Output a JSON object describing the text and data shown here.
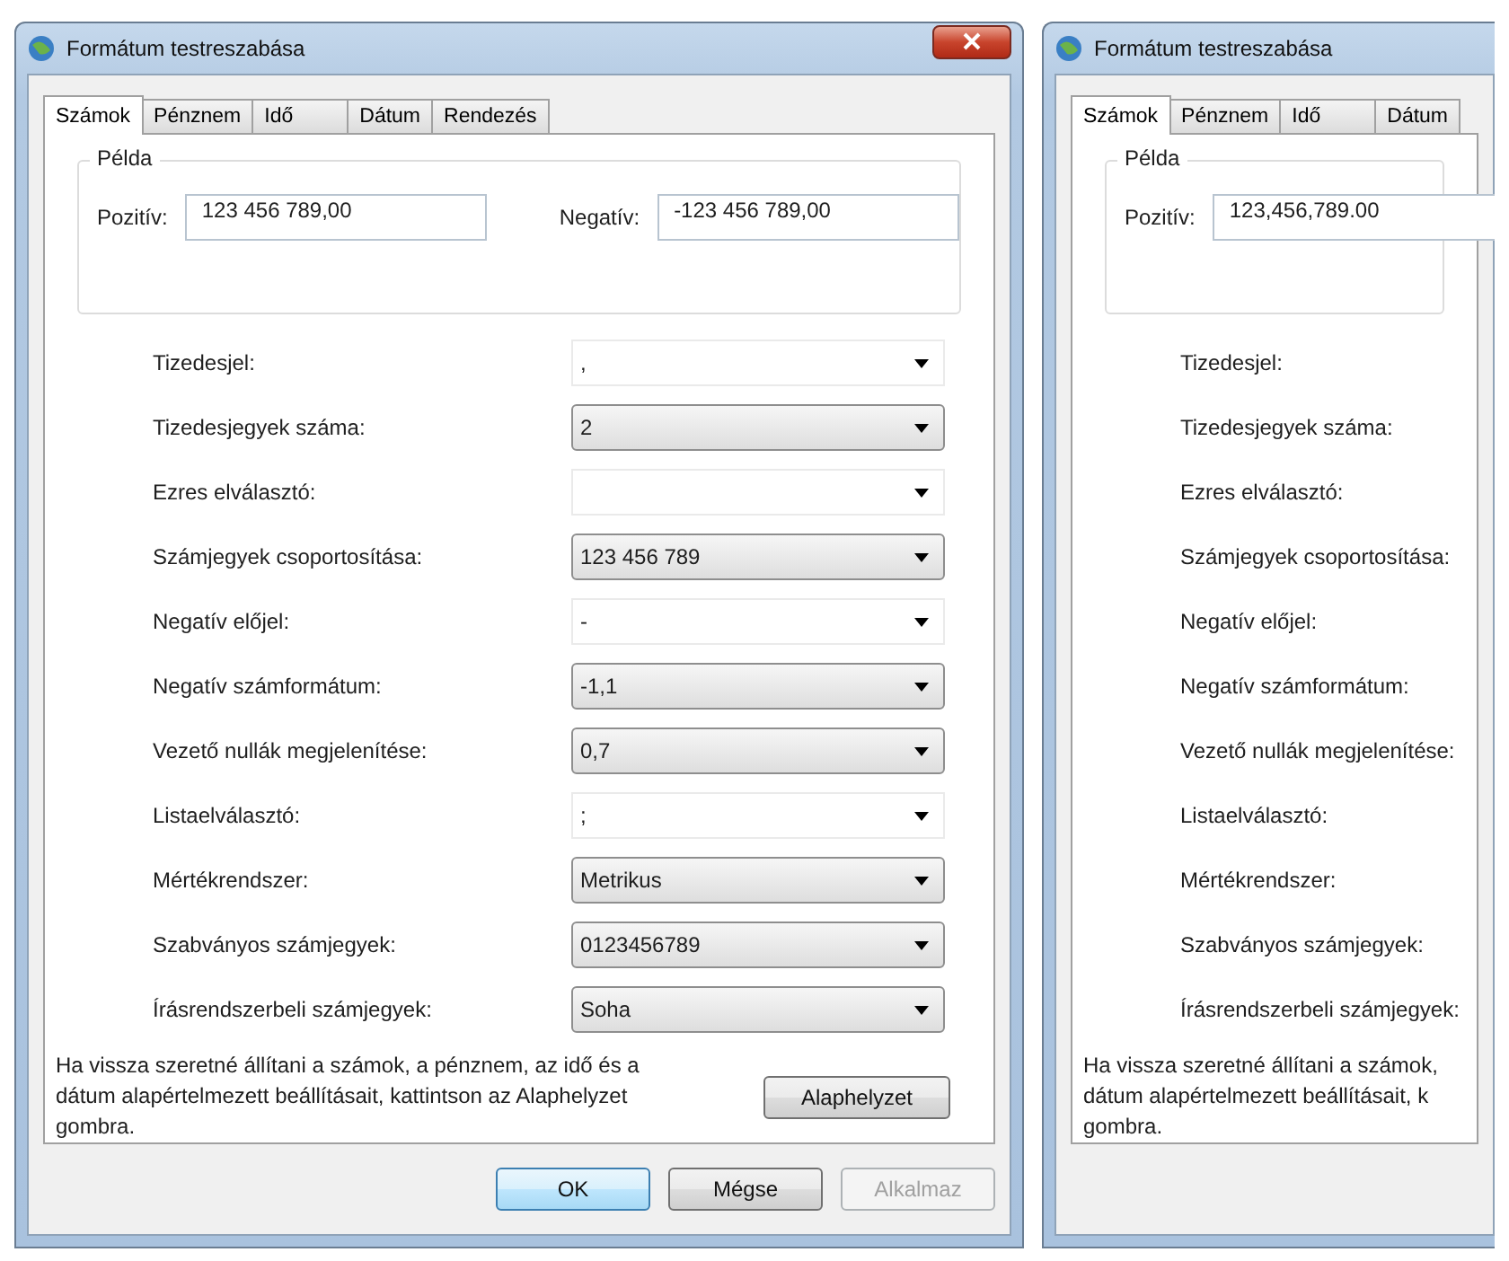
{
  "dialogs": [
    {
      "title": "Formátum testreszabása",
      "close_button": true,
      "tabs": [
        {
          "label": "Számok",
          "selected": true
        },
        {
          "label": "Pénznem",
          "selected": false
        },
        {
          "label": "Idő",
          "selected": false
        },
        {
          "label": "Dátum",
          "selected": false
        },
        {
          "label": "Rendezés",
          "selected": false
        }
      ],
      "example": {
        "title": "Példa",
        "fields": [
          {
            "label": "Pozitív:",
            "value": "123 456 789,00"
          },
          {
            "label": "Negatív:",
            "value": "-123 456 789,00"
          }
        ]
      },
      "rows": [
        {
          "label": "Tizedesjel:",
          "value": ",",
          "kind": "editable"
        },
        {
          "label": "Tizedesjegyek száma:",
          "value": "2",
          "kind": "list"
        },
        {
          "label": "Ezres elválasztó:",
          "value": "",
          "kind": "editable"
        },
        {
          "label": "Számjegyek csoportosítása:",
          "value": "123 456 789",
          "kind": "list"
        },
        {
          "label": "Negatív előjel:",
          "value": "-",
          "kind": "editable"
        },
        {
          "label": "Negatív számformátum:",
          "value": "-1,1",
          "kind": "list"
        },
        {
          "label": "Vezető nullák megjelenítése:",
          "value": "0,7",
          "kind": "list"
        },
        {
          "label": "Listaelválasztó:",
          "value": ";",
          "kind": "editable"
        },
        {
          "label": "Mértékrendszer:",
          "value": "Metrikus",
          "kind": "list"
        },
        {
          "label": "Szabványos számjegyek:",
          "value": "0123456789",
          "kind": "list"
        },
        {
          "label": "Írásrendszerbeli számjegyek:",
          "value": "Soha",
          "kind": "list"
        }
      ],
      "note_lines": [
        "Ha vissza szeretné állítani a számok, a pénznem, az idő és a",
        "dátum alapértelmezett beállításait, kattintson az Alaphelyzet",
        "gombra."
      ],
      "reset_button": "Alaphelyzet",
      "buttons": [
        {
          "label": "OK",
          "default": true,
          "disabled": false
        },
        {
          "label": "Mégse",
          "default": false,
          "disabled": false
        },
        {
          "label": "Alkalmaz",
          "default": false,
          "disabled": true
        }
      ]
    },
    {
      "title": "Formátum testreszabása",
      "close_button": false,
      "tabs": [
        {
          "label": "Számok",
          "selected": true
        },
        {
          "label": "Pénznem",
          "selected": false
        },
        {
          "label": "Idő",
          "selected": false
        },
        {
          "label": "Dátum",
          "selected": false
        }
      ],
      "example": {
        "title": "Példa",
        "fields": [
          {
            "label": "Pozitív:",
            "value": "123,456,789.00"
          }
        ]
      },
      "rows": [
        {
          "label": "Tizedesjel:"
        },
        {
          "label": "Tizedesjegyek száma:"
        },
        {
          "label": "Ezres elválasztó:"
        },
        {
          "label": "Számjegyek csoportosítása:"
        },
        {
          "label": "Negatív előjel:"
        },
        {
          "label": "Negatív számformátum:"
        },
        {
          "label": "Vezető nullák megjelenítése:"
        },
        {
          "label": "Listaelválasztó:"
        },
        {
          "label": "Mértékrendszer:"
        },
        {
          "label": "Szabványos számjegyek:"
        },
        {
          "label": "Írásrendszerbeli számjegyek:"
        }
      ],
      "note_lines": [
        "Ha vissza szeretné állítani a számok,",
        "dátum alapértelmezett beállításait, k",
        "gombra."
      ]
    }
  ]
}
